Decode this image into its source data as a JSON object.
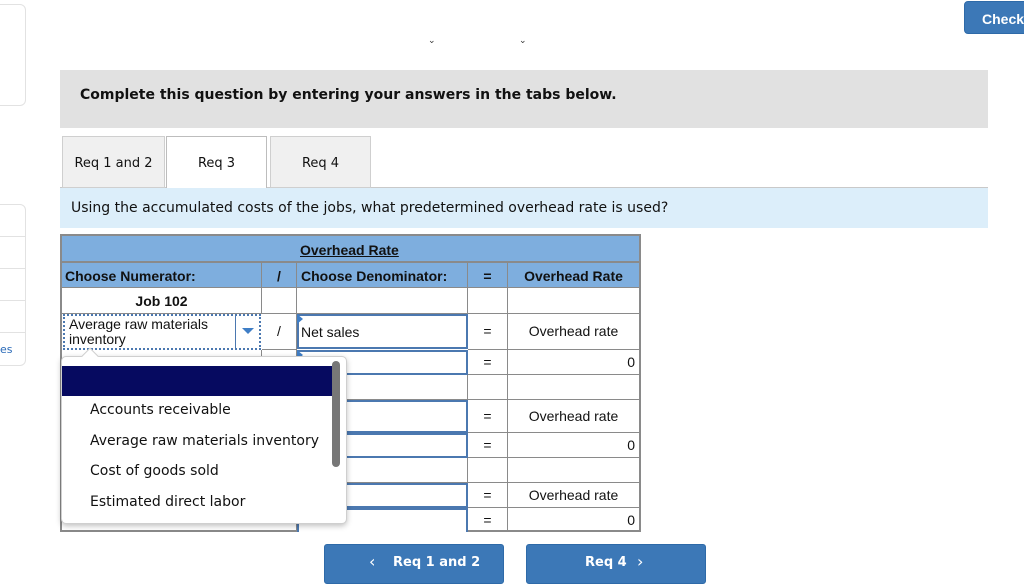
{
  "header": {
    "check_label": "Check"
  },
  "sidebar": {
    "partial_link": "es"
  },
  "instruction": "Complete this question by entering your answers in the tabs below.",
  "tabs": [
    {
      "label": "Req 1 and 2",
      "active": false
    },
    {
      "label": "Req 3",
      "active": true
    },
    {
      "label": "Req 4",
      "active": false
    }
  ],
  "question": "Using the accumulated costs of the jobs, what predetermined overhead rate is used?",
  "table": {
    "title": "Overhead Rate",
    "headers": {
      "numerator": "Choose Numerator:",
      "divide": "/",
      "denominator": "Choose Denominator:",
      "equals": "=",
      "rate": "Overhead Rate"
    },
    "job_label": "Job 102",
    "rows": [
      {
        "numerator": "Average raw materials inventory",
        "divide": "/",
        "denominator": "Net sales",
        "equals": "=",
        "rate": "Overhead rate"
      },
      {
        "numerator": "",
        "divide": "/",
        "denominator": "",
        "equals": "=",
        "rate": "0"
      },
      {
        "numerator": "",
        "divide": "",
        "denominator": "",
        "equals": "=",
        "rate": "Overhead rate"
      },
      {
        "numerator": "",
        "divide": "",
        "denominator": "",
        "equals": "=",
        "rate": "0"
      },
      {
        "numerator": "",
        "divide": "",
        "denominator": "",
        "equals": "=",
        "rate": "Overhead rate"
      },
      {
        "numerator": "",
        "divide": "",
        "denominator": "",
        "equals": "=",
        "rate": "0"
      }
    ]
  },
  "dropdown": {
    "highlighted": "",
    "options": [
      "Accounts receivable",
      "Average raw materials inventory",
      "Cost of goods sold",
      "Estimated direct labor"
    ]
  },
  "nav": {
    "prev_label": "Req 1 and 2",
    "next_label": "Req 4",
    "prev_icon": "‹",
    "next_icon": "›"
  }
}
